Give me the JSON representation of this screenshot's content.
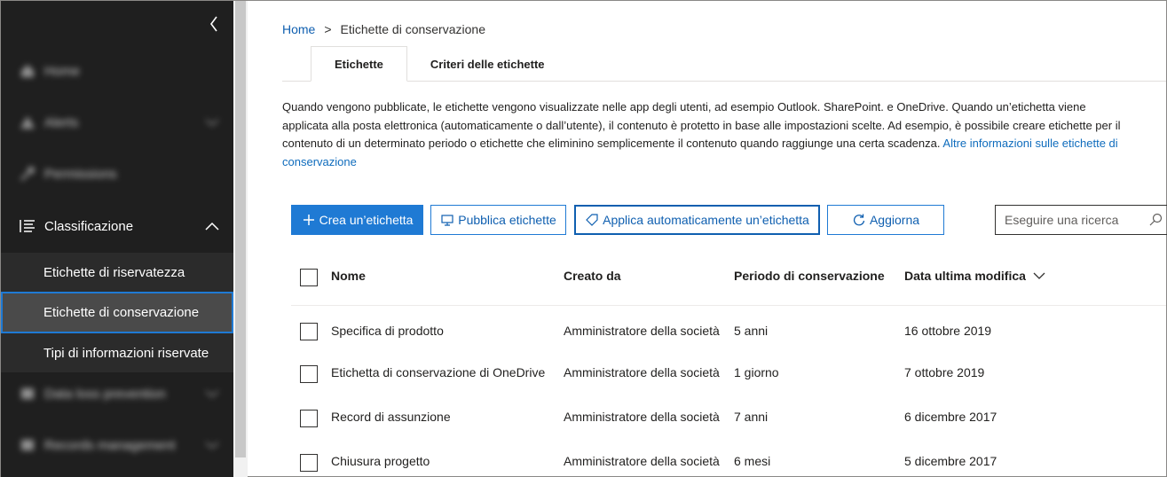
{
  "sidebar": {
    "items": [
      {
        "label": "Home",
        "icon": "home-icon",
        "blurred": true
      },
      {
        "label": "Alerts",
        "icon": "alert-icon",
        "blurred": true,
        "expandable": true
      },
      {
        "label": "Permissions",
        "icon": "key-icon",
        "blurred": true
      },
      {
        "label": "Classificazione",
        "icon": "list-icon",
        "blurred": false,
        "expanded": true
      },
      {
        "label": "Data loss prevention",
        "icon": "shield-icon",
        "blurred": true,
        "expandable": true
      },
      {
        "label": "Records management",
        "icon": "records-icon",
        "blurred": true,
        "expandable": true
      }
    ],
    "subitems": [
      {
        "label": "Etichette di riservatezza",
        "active": false
      },
      {
        "label": "Etichette di conservazione",
        "active": true
      },
      {
        "label": "Tipi di informazioni riservate",
        "active": false
      }
    ]
  },
  "breadcrumb": {
    "home": "Home",
    "separator": ">",
    "current": "Etichette di conservazione"
  },
  "tabs": [
    {
      "label": "Etichette",
      "active": true
    },
    {
      "label": "Criteri delle etichette",
      "active": false
    }
  ],
  "description": {
    "text": "Quando vengono pubblicate, le etichette vengono visualizzate nelle app degli utenti, ad esempio Outlook. SharePoint. e OneDrive. Quando un’etichetta viene applicata alla posta elettronica (automaticamente o dall’utente), il contenuto è protetto in base alle impostazioni scelte. Ad esempio, è possibile creare etichette per il contenuto di un determinato periodo o etichette che eliminino semplicemente il contenuto quando raggiunge una certa scadenza.",
    "link": "Altre informazioni sulle etichette di conservazione"
  },
  "toolbar": {
    "create": "Crea un’etichetta",
    "publish": "Pubblica etichette",
    "auto_apply": "Applica automaticamente un’etichetta",
    "refresh": "Aggiorna",
    "search_placeholder": "Eseguire una ricerca"
  },
  "table": {
    "columns": [
      "Nome",
      "Creato da",
      "Periodo di conservazione",
      "Data ultima modifica"
    ],
    "rows": [
      [
        "Specifica di prodotto",
        "Amministratore della società",
        "5 anni",
        "16 ottobre 2019"
      ],
      [
        "Etichetta di conservazione di OneDrive",
        "Amministratore della società",
        "1 giorno",
        "7 ottobre 2019"
      ],
      [
        "Record di assunzione",
        "Amministratore della società",
        "7 anni",
        "6 dicembre 2017"
      ],
      [
        "Chiusura progetto",
        "Amministratore della società",
        "6 mesi",
        "5 dicembre 2017"
      ]
    ]
  },
  "colors": {
    "accent": "#1f7ad4",
    "sidebar_bg": "#1f1f1f",
    "link": "#0f6cbd"
  }
}
